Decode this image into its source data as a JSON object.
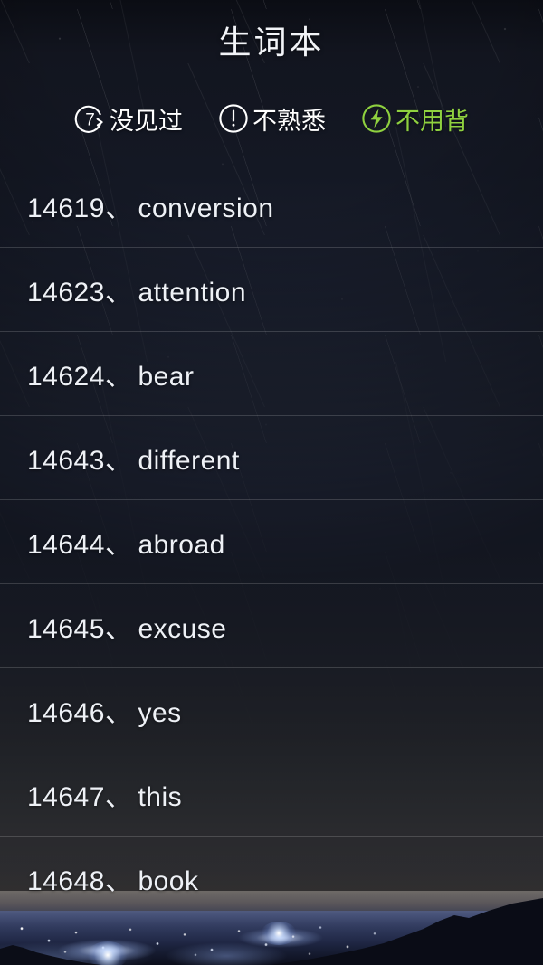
{
  "header": {
    "title": "生词本"
  },
  "tabbar": {
    "tabs": [
      {
        "icon": "repeat-seven-icon",
        "label": "没见过",
        "color": "#ffffff"
      },
      {
        "icon": "exclamation-circle-icon",
        "label": "不熟悉",
        "color": "#ffffff"
      },
      {
        "icon": "lightning-circle-icon",
        "label": "不用背",
        "color": "#8fd13f"
      }
    ],
    "badge_number": "7"
  },
  "wordlist": {
    "separator": "、",
    "rows": [
      {
        "index": "14619",
        "word": "conversion"
      },
      {
        "index": "14623",
        "word": "attention"
      },
      {
        "index": "14624",
        "word": "bear"
      },
      {
        "index": "14643",
        "word": "different"
      },
      {
        "index": "14644",
        "word": "abroad"
      },
      {
        "index": "14645",
        "word": "excuse"
      },
      {
        "index": "14646",
        "word": "yes"
      },
      {
        "index": "14647",
        "word": "this"
      },
      {
        "index": "14648",
        "word": "book"
      }
    ]
  }
}
